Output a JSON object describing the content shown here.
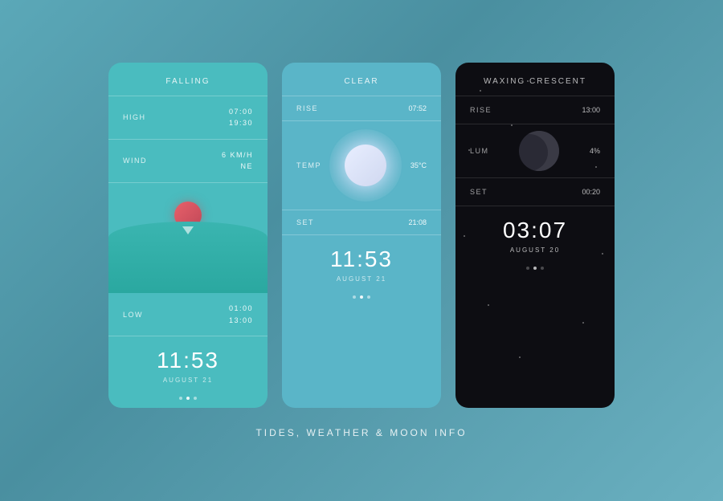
{
  "page": {
    "title": "TIDES, WEATHER & MOON INFO",
    "background_color": "#5ba8b8"
  },
  "tides_card": {
    "header": "FALLING",
    "high_label": "HIGH",
    "high_times": "07:00\n19:30",
    "wind_label": "WIND",
    "wind_value": "6 KM/H\nNE",
    "low_label": "LOW",
    "low_times": "01:00\n13:00",
    "time": "11:53",
    "date": "AUGUST 21",
    "dots": [
      "inactive",
      "active",
      "inactive"
    ]
  },
  "weather_card": {
    "header": "CLEAR",
    "rise_label": "RISE",
    "rise_value": "07:52",
    "temp_label": "TEMP",
    "temp_value": "35°C",
    "set_label": "SET",
    "set_value": "21:08",
    "time": "11:53",
    "date": "AUGUST 21",
    "dots": [
      "inactive",
      "active",
      "inactive"
    ]
  },
  "moon_card": {
    "header": "WAXING CRESCENT",
    "rise_label": "RISE",
    "rise_value": "13:00",
    "lum_label": "LUM",
    "lum_value": "4%",
    "set_label": "SET",
    "set_value": "00:20",
    "time": "03:07",
    "date": "AUGUST 20",
    "dots": [
      "inactive",
      "active",
      "inactive"
    ]
  }
}
